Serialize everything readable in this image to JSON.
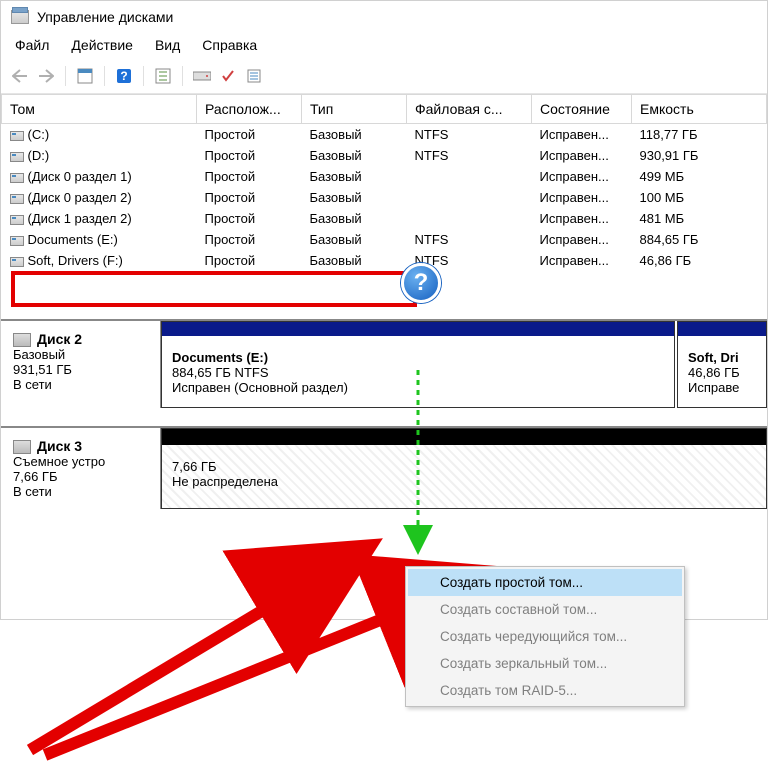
{
  "window": {
    "title": "Управление дисками"
  },
  "menu": {
    "file": "Файл",
    "action": "Действие",
    "view": "Вид",
    "help": "Справка"
  },
  "columns": {
    "volume": "Том",
    "layout": "Располож...",
    "type": "Тип",
    "fs": "Файловая с...",
    "status": "Состояние",
    "capacity": "Емкость"
  },
  "volumes": [
    {
      "name": "(C:)",
      "layout": "Простой",
      "type": "Базовый",
      "fs": "NTFS",
      "status": "Исправен...",
      "cap": "118,77 ГБ"
    },
    {
      "name": "(D:)",
      "layout": "Простой",
      "type": "Базовый",
      "fs": "NTFS",
      "status": "Исправен...",
      "cap": "930,91 ГБ"
    },
    {
      "name": "(Диск 0 раздел 1)",
      "layout": "Простой",
      "type": "Базовый",
      "fs": "",
      "status": "Исправен...",
      "cap": "499 МБ"
    },
    {
      "name": "(Диск 0 раздел 2)",
      "layout": "Простой",
      "type": "Базовый",
      "fs": "",
      "status": "Исправен...",
      "cap": "100 МБ"
    },
    {
      "name": "(Диск 1 раздел 2)",
      "layout": "Простой",
      "type": "Базовый",
      "fs": "",
      "status": "Исправен...",
      "cap": "481 МБ"
    },
    {
      "name": "Documents (E:)",
      "layout": "Простой",
      "type": "Базовый",
      "fs": "NTFS",
      "status": "Исправен...",
      "cap": "884,65 ГБ"
    },
    {
      "name": "Soft, Drivers (F:)",
      "layout": "Простой",
      "type": "Базовый",
      "fs": "NTFS",
      "status": "Исправен...",
      "cap": "46,86 ГБ"
    }
  ],
  "disk2": {
    "name": "Диск 2",
    "type": "Базовый",
    "size": "931,51 ГБ",
    "status": "В сети",
    "part1": {
      "title": "Documents  (E:)",
      "sub": "884,65 ГБ NTFS",
      "stat": "Исправен (Основной раздел)"
    },
    "part2": {
      "title": "Soft, Dri",
      "sub": "46,86 ГБ",
      "stat": "Исправе"
    }
  },
  "disk3": {
    "name": "Диск 3",
    "type": "Съемное устро",
    "size": "7,66 ГБ",
    "status": "В сети",
    "part": {
      "sub": "7,66 ГБ",
      "stat": "Не распределена"
    }
  },
  "context_menu": {
    "simple": "Создать простой том...",
    "spanned": "Создать составной том...",
    "striped": "Создать чередующийся том...",
    "mirrored": "Создать зеркальный том...",
    "raid5": "Создать том RAID-5..."
  },
  "annotations": {
    "question": "?"
  }
}
